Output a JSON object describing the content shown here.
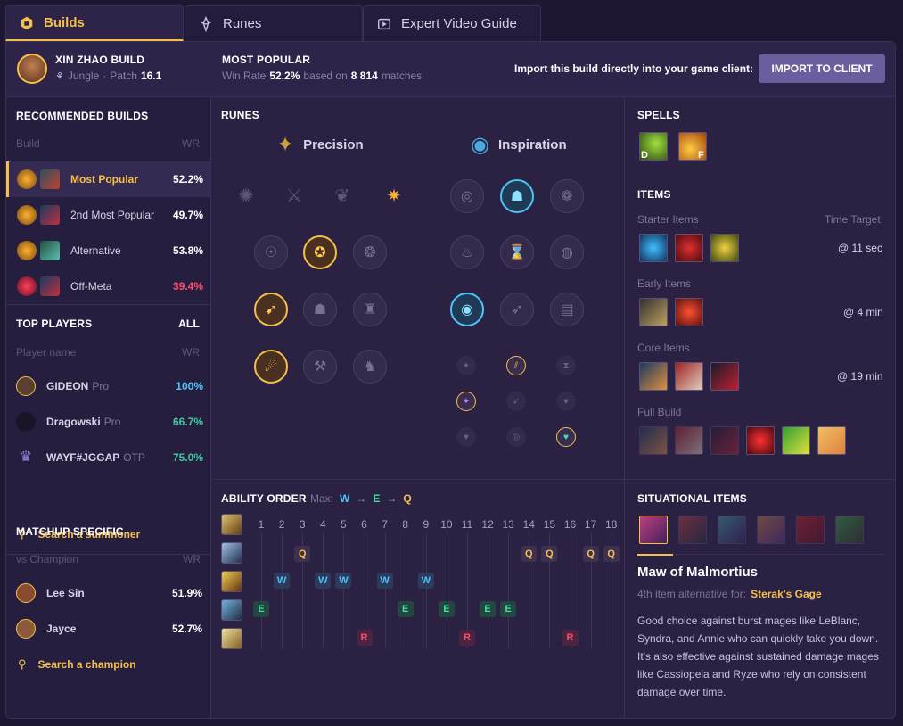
{
  "tabs": [
    {
      "label": "Builds",
      "icon": "builds-icon",
      "active": true
    },
    {
      "label": "Runes",
      "icon": "runes-icon"
    },
    {
      "label": "Expert Video Guide",
      "icon": "video-icon"
    }
  ],
  "header": {
    "champion_build": "XIN ZHAO BUILD",
    "role": "Jungle",
    "patch_label": "Patch",
    "patch": "16.1",
    "most_popular": "MOST POPULAR",
    "win_rate_label": "Win Rate",
    "win_rate": "52.2%",
    "based_on": "based on",
    "matches_count": "8 814",
    "matches_label": "matches",
    "import_text": "Import this build directly into your game client:",
    "import_button": "IMPORT TO CLIENT"
  },
  "recommended": {
    "title": "RECOMMENDED BUILDS",
    "col_build": "Build",
    "col_wr": "WR",
    "items": [
      {
        "name": "Most Popular",
        "wr": "52.2%",
        "selected": true
      },
      {
        "name": "2nd Most Popular",
        "wr": "49.7%"
      },
      {
        "name": "Alternative",
        "wr": "53.8%"
      },
      {
        "name": "Off-Meta",
        "wr": "39.4%"
      }
    ]
  },
  "top_players": {
    "title": "TOP PLAYERS",
    "all": "ALL",
    "col_name": "Player name",
    "col_wr": "WR",
    "players": [
      {
        "name": "GIDEON",
        "tag": "Pro",
        "wr": "100%"
      },
      {
        "name": "Dragowski",
        "tag": "Pro",
        "wr": "66.7%"
      },
      {
        "name": "WAYF#JGGAP",
        "tag": "OTP",
        "wr": "75.0%"
      }
    ],
    "search": "Search a summoner"
  },
  "matchup": {
    "title": "MATCHUP SPECIFIC",
    "col_vs": "vs Champion",
    "col_wr": "WR",
    "items": [
      {
        "name": "Lee Sin",
        "wr": "51.9%"
      },
      {
        "name": "Jayce",
        "wr": "52.7%"
      }
    ],
    "search": "Search a champion"
  },
  "runes": {
    "title": "RUNES",
    "primary": "Precision",
    "secondary": "Inspiration"
  },
  "spells": {
    "title": "SPELLS",
    "keys": [
      "D",
      "F"
    ]
  },
  "items": {
    "title": "ITEMS",
    "starter": "Starter Items",
    "time_target": "Time Target",
    "starter_time": "@ 11 sec",
    "early": "Early Items",
    "early_time": "@ 4 min",
    "core": "Core Items",
    "core_time": "@ 19 min",
    "full": "Full Build"
  },
  "ability": {
    "title": "ABILITY ORDER",
    "max_label": "Max:",
    "max_order": [
      "W",
      "E",
      "Q"
    ],
    "arrow": "→",
    "levels": [
      "1",
      "2",
      "3",
      "4",
      "5",
      "6",
      "7",
      "8",
      "9",
      "10",
      "11",
      "12",
      "13",
      "14",
      "15",
      "16",
      "17",
      "18"
    ],
    "sequence": [
      "E",
      "W",
      "Q",
      "W",
      "W",
      "R",
      "W",
      "E",
      "W",
      "E",
      "R",
      "E",
      "E",
      "Q",
      "Q",
      "R",
      "Q",
      "Q"
    ]
  },
  "situational": {
    "title": "SITUATIONAL ITEMS",
    "item_name": "Maw of Malmortius",
    "alt_prefix": "4th item alternative for:",
    "alt_item": "Sterak's Gage",
    "desc": "Good choice against burst mages like LeBlanc, Syndra, and Annie who can quickly take you down. It's also effective against sustained damage mages like Cassiopeia and Ryze who rely on consistent damage over time."
  }
}
